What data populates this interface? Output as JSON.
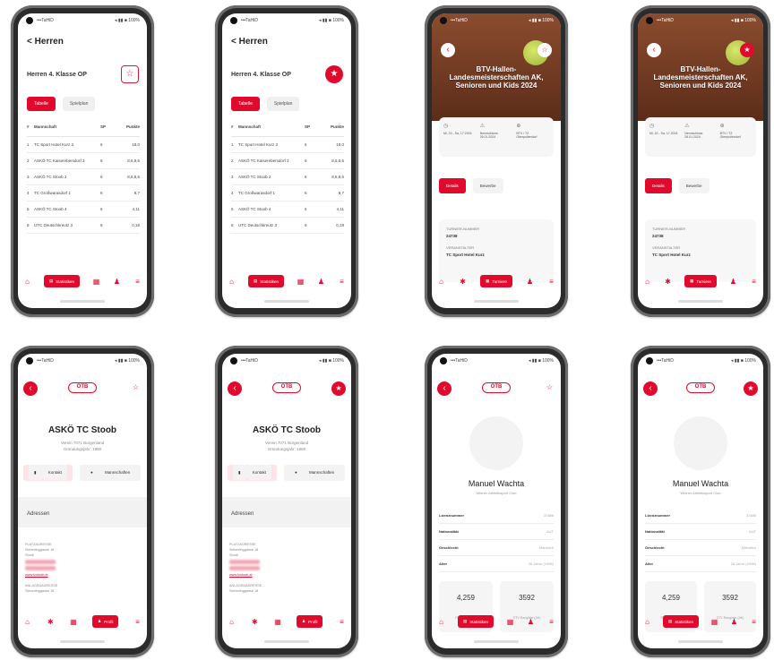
{
  "common": {
    "status_carrier": "•••TaHiD",
    "status_right": "◂ ▮▮ ■ 100%"
  },
  "ranking": {
    "back_title": "< Herren",
    "subtitle": "Herren 4. Klasse OP",
    "tabs": [
      "Tabelle",
      "Spielplan"
    ],
    "headers": [
      "#",
      "Mannschaft",
      "SP",
      "Punkte"
    ],
    "rows": [
      [
        "1",
        "TC Sport Hotel Kurz 3",
        "6",
        "18,0"
      ],
      [
        "2",
        "ASKÖ TC Kaiserebersdorf 3",
        "6",
        "8,6,8,6"
      ],
      [
        "3",
        "ASKÖ TC Stoob 2",
        "6",
        "8,6,8,6"
      ],
      [
        "4",
        "TC Großwarasdorf 1",
        "6",
        "8,7"
      ],
      [
        "5",
        "ASKÖ TC Stoob 4",
        "6",
        "4,11"
      ],
      [
        "6",
        "UTC Deutschkreutz 3",
        "6",
        "0,18"
      ]
    ],
    "nav_label": "Statistiken"
  },
  "event": {
    "title": "BTV-Hallen-Landesmeisterschaften AK, Senioren und Kids 2024",
    "info": [
      {
        "icon": "◷",
        "text": "Mi, 22.- Sa, 17.2024"
      },
      {
        "icon": "⚠",
        "text": "Nennschluss 26.01.2024"
      },
      {
        "icon": "⊕",
        "text": "BTV / TZ Oberpullendorf"
      }
    ],
    "tabs": [
      "Details",
      "Bewerbe"
    ],
    "turnier_label": "TURNIER-NUMMER",
    "turnier_value": "24738",
    "veranst_label": "VERANSTALTER",
    "veranst_value": "TC Sport Hotel Kurz",
    "nav_label": "Turniere"
  },
  "club": {
    "logo": "ÖTB",
    "name": "ASKÖ TC Stoob",
    "sub1": "Verein 7071 Burgenland",
    "sub2": "Gründungsjahr: 1980",
    "tabs": [
      "Kontakt",
      "Mannschaften"
    ],
    "section": "Adressen",
    "addr_title": "PLATZADRESSE",
    "addr_lines": [
      "Sieberlinggasse 18",
      "Stoob"
    ],
    "link": "www.tcstoob.at",
    "addr2_title": "ANLAGENADRESSE",
    "addr2_line": "Sieberlinggasse 18",
    "nav_label": "Profil"
  },
  "player": {
    "logo": "ÖTB",
    "name": "Manuel Wachta",
    "club": "Wiener Athletiksport Club",
    "rows": [
      [
        "Lizenznummer",
        "37886"
      ],
      [
        "Nationalität",
        "AUT"
      ],
      [
        "Geschlecht",
        "Männlich"
      ],
      [
        "Alter",
        "26 Jahre (1998)"
      ]
    ],
    "stats": [
      {
        "num": "4,259",
        "lab": "ITN Spielstärke"
      },
      {
        "num": "3592",
        "lab": "ÖTV Rangliste (AK)"
      }
    ],
    "nav_label": "Statistiken"
  }
}
